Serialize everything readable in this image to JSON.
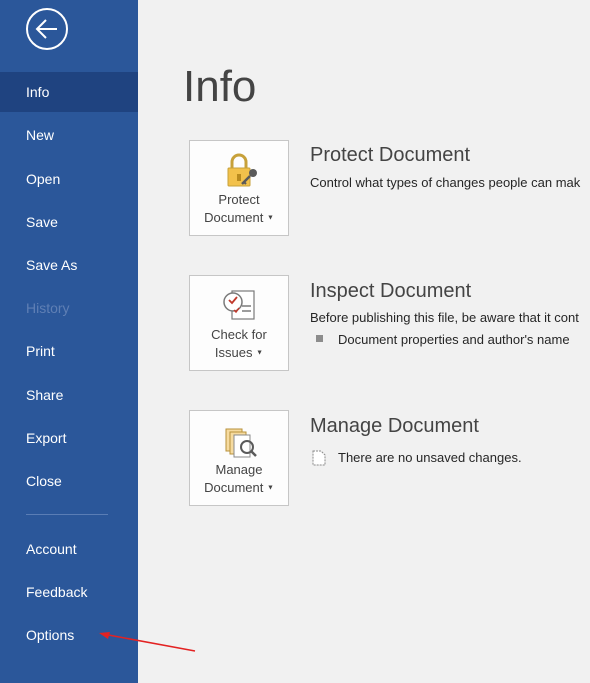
{
  "sidebar": {
    "back_icon": "back-arrow-icon",
    "items": [
      {
        "label": "Info",
        "state": "active"
      },
      {
        "label": "New",
        "state": "normal"
      },
      {
        "label": "Open",
        "state": "normal"
      },
      {
        "label": "Save",
        "state": "normal"
      },
      {
        "label": "Save As",
        "state": "normal"
      },
      {
        "label": "History",
        "state": "disabled"
      },
      {
        "label": "Print",
        "state": "normal"
      },
      {
        "label": "Share",
        "state": "normal"
      },
      {
        "label": "Export",
        "state": "normal"
      },
      {
        "label": "Close",
        "state": "normal"
      },
      {
        "label": "Account",
        "state": "normal"
      },
      {
        "label": "Feedback",
        "state": "normal"
      },
      {
        "label": "Options",
        "state": "normal"
      }
    ]
  },
  "main": {
    "title": "Info",
    "sections": [
      {
        "tile_line1": "Protect",
        "tile_line2": "Document",
        "tile_icon": "lock-key-icon",
        "heading": "Protect Document",
        "description": "Control what types of changes people can mak"
      },
      {
        "tile_line1": "Check for",
        "tile_line2": "Issues",
        "tile_icon": "checklist-icon",
        "heading": "Inspect Document",
        "description": "Before publishing this file, be aware that it cont",
        "bullet": "Document properties and author's name"
      },
      {
        "tile_line1": "Manage",
        "tile_line2": "Document",
        "tile_icon": "manage-document-icon",
        "heading": "Manage Document",
        "status": "There are no unsaved changes."
      }
    ]
  },
  "annotation": {
    "arrow_color": "#e32222",
    "points_to": "Options"
  },
  "colors": {
    "sidebar": "#2b579a",
    "sidebar_active": "#1f4380",
    "background": "#f1f1f1"
  }
}
